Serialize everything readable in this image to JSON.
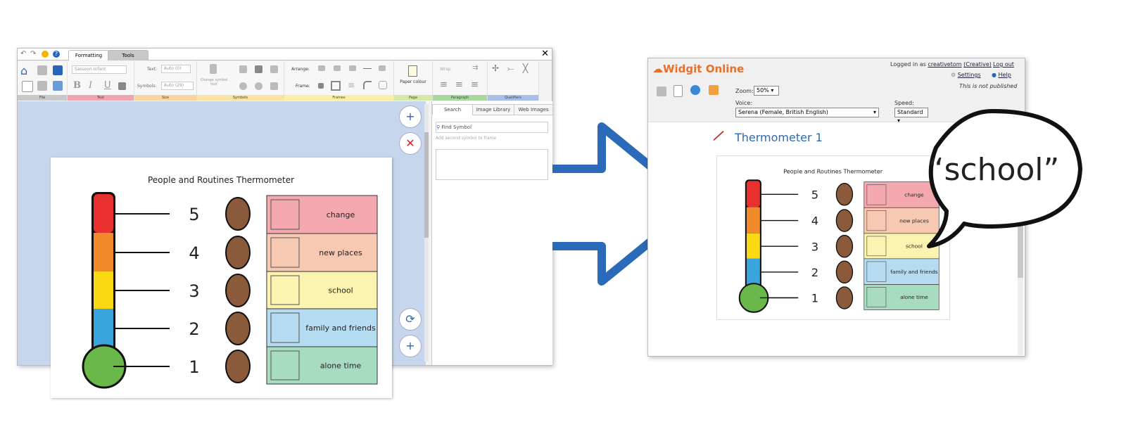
{
  "editor": {
    "tabs": [
      "Formatting",
      "Tools"
    ],
    "groups": {
      "file": "File",
      "text": "Text",
      "size": "Size",
      "symbols": "Symbols",
      "frames": "Frames",
      "page": "Page",
      "paragraph": "Paragraph",
      "qualifiers": "Qualifiers"
    },
    "font": "Sassoon Infant",
    "text_label": "Text:",
    "text_value": "Auto (0)",
    "symbols_label": "Symbols:",
    "symbols_value": "Auto (29)",
    "change_symbol_text": "Change symbol text",
    "arrange_label": "Arrange:",
    "frame_label": "Frame:",
    "paper_colour": "Paper colour",
    "wrap": "Wrap",
    "panel_tabs": [
      "Search",
      "Image Library",
      "Web Images"
    ],
    "find_placeholder": "Find Symbol",
    "add_second": "Add second symbol to frame"
  },
  "document": {
    "title": "People and Routines Thermometer",
    "levels": [
      {
        "number": "5",
        "label": "change",
        "band": "#e8312f",
        "row": "#f4a9b0",
        "face": "angry"
      },
      {
        "number": "4",
        "label": "new places",
        "band": "#f08a2a",
        "row": "#f7c9b3",
        "face": "upset"
      },
      {
        "number": "3",
        "label": "school",
        "band": "#fbd914",
        "row": "#fbf3b0",
        "face": "worried"
      },
      {
        "number": "2",
        "label": "family and friends",
        "band": "#3aa4dc",
        "row": "#b5dcf0",
        "face": "neutral"
      },
      {
        "number": "1",
        "label": "alone time",
        "band": "#6ab84a",
        "row": "#a8dcc0",
        "face": "happy"
      }
    ]
  },
  "viewer": {
    "logo": "Widgit Online",
    "logged_in": "Logged in as",
    "user": "creativetom",
    "role": "(Creative)",
    "logout": "Log out",
    "settings": "Settings",
    "help": "Help",
    "status": "This is not published",
    "zoom_label": "Zoom:",
    "zoom_value": "50%",
    "voice_label": "Voice:",
    "voice_value": "Serena (Female, British English)",
    "speed_label": "Speed:",
    "speed_value": "Standard",
    "doc_title": "Thermometer 1",
    "speech": "“school”"
  },
  "colors": {
    "accent": "#2a6ab8",
    "arrow": "#2a6ab8"
  }
}
